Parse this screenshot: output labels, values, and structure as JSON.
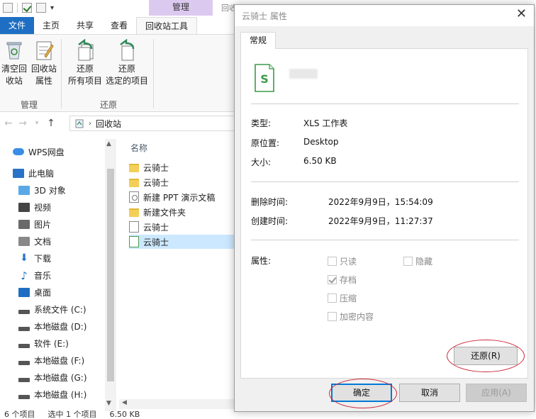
{
  "explorer": {
    "ribbon_context_tab": "管理",
    "window_title_partial": "回收",
    "tabs": [
      "文件",
      "主页",
      "共享",
      "查看",
      "回收站工具"
    ],
    "ribbon": {
      "empty_bin": [
        "清空回",
        "收站"
      ],
      "bin_props": [
        "回收站",
        "属性"
      ],
      "restore_all": [
        "还原",
        "所有项目"
      ],
      "restore_selected": [
        "还原",
        "选定的项目"
      ],
      "group_manage": "管理",
      "group_restore": "还原"
    },
    "address": "回收站",
    "nav_items": [
      {
        "label": "WPS网盘",
        "icon": "cloud-icon"
      },
      {
        "label": "此电脑",
        "icon": "computer-icon"
      },
      {
        "label": "3D 对象",
        "icon": "cube-icon"
      },
      {
        "label": "视频",
        "icon": "video-icon"
      },
      {
        "label": "图片",
        "icon": "picture-icon"
      },
      {
        "label": "文档",
        "icon": "document-icon"
      },
      {
        "label": "下载",
        "icon": "download-icon"
      },
      {
        "label": "音乐",
        "icon": "music-icon"
      },
      {
        "label": "桌面",
        "icon": "desktop-icon"
      },
      {
        "label": "系统文件 (C:)",
        "icon": "drive-icon"
      },
      {
        "label": "本地磁盘 (D:)",
        "icon": "drive-icon"
      },
      {
        "label": "软件 (E:)",
        "icon": "drive-icon"
      },
      {
        "label": "本地磁盘 (F:)",
        "icon": "drive-icon"
      },
      {
        "label": "本地磁盘 (G:)",
        "icon": "drive-icon"
      },
      {
        "label": "本地磁盘 (H:)",
        "icon": "drive-icon"
      }
    ],
    "column_name": "名称",
    "files": [
      {
        "name": "云骑士",
        "type": "folder"
      },
      {
        "name": "云骑士",
        "type": "folder"
      },
      {
        "name": "新建 PPT 演示文稿",
        "type": "ppt"
      },
      {
        "name": "新建文件夹",
        "type": "folder"
      },
      {
        "name": "云骑士",
        "type": "doc"
      },
      {
        "name": "云骑士",
        "type": "xls",
        "selected": true
      }
    ],
    "status": {
      "count": "6 个项目",
      "selected": "选中 1 个项目",
      "size": "6.50 KB"
    }
  },
  "dialog": {
    "title": "云骑士 属性",
    "tab": "常规",
    "info": [
      {
        "label": "类型:",
        "value": "XLS 工作表"
      },
      {
        "label": "原位置:",
        "value": "Desktop"
      },
      {
        "label": "大小:",
        "value": "6.50 KB"
      }
    ],
    "dates": [
      {
        "label": "删除时间:",
        "value": "2022年9月9日，15:54:09"
      },
      {
        "label": "创建时间:",
        "value": "2022年9月9日，11:27:37"
      }
    ],
    "attributes_label": "属性:",
    "attributes": {
      "readonly": {
        "label": "只读",
        "checked": false
      },
      "hidden": {
        "label": "隐藏",
        "checked": false
      },
      "archive": {
        "label": "存档",
        "checked": true
      },
      "compress": {
        "label": "压缩",
        "checked": false
      },
      "encrypt": {
        "label": "加密内容",
        "checked": false
      }
    },
    "buttons": {
      "restore": "还原(R)",
      "ok": "确定",
      "cancel": "取消",
      "apply": "应用(A)"
    },
    "highlight_color": "#cc2b3a"
  }
}
